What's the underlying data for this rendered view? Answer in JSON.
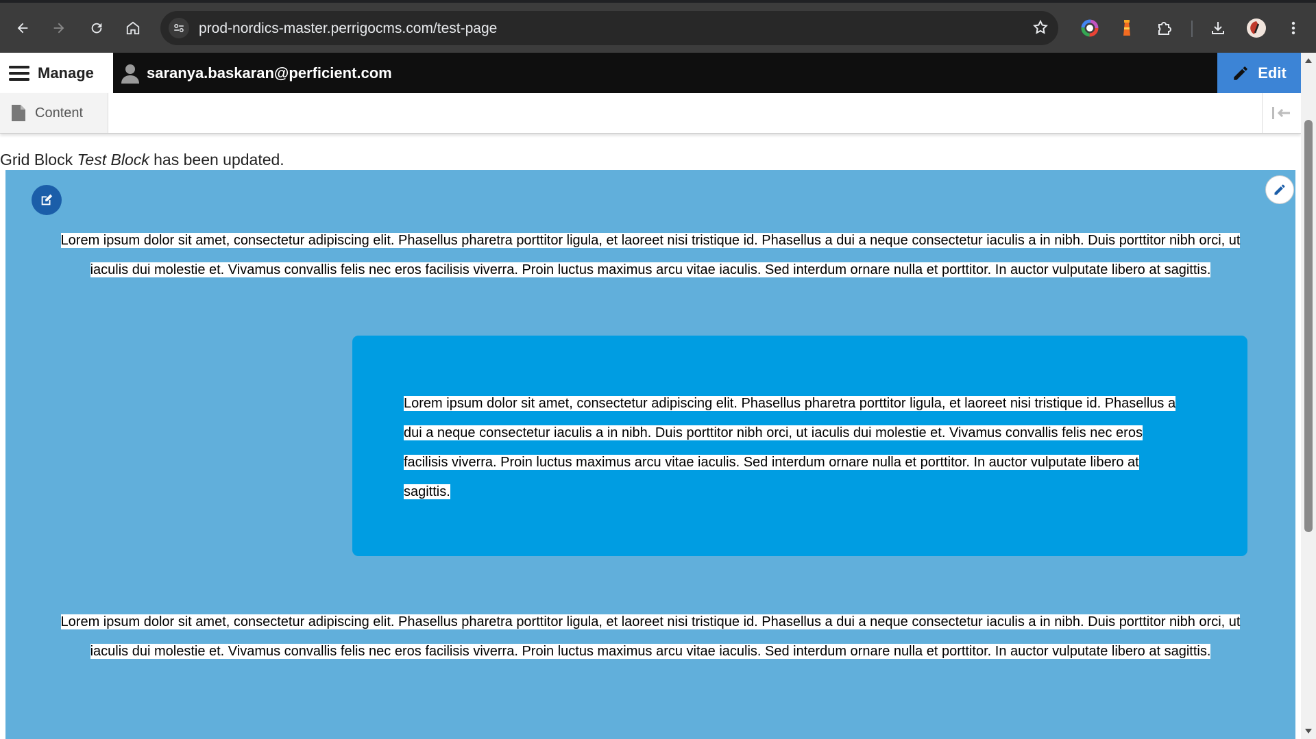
{
  "browser": {
    "url": "prod-nordics-master.perrigocms.com/test-page"
  },
  "toolbar": {
    "manage_label": "Manage",
    "user_label": "saranya.baskaran@perficient.com",
    "edit_label": "Edit",
    "tray_content_label": "Content"
  },
  "status": {
    "prefix": "Grid Block ",
    "block_name": "Test Block",
    "suffix": " has been updated."
  },
  "grid_block": {
    "background_color": "#61afdb",
    "top_text": "Lorem ipsum dolor sit amet, consectetur adipiscing elit. Phasellus pharetra porttitor ligula, et laoreet nisi tristique id. Phasellus a dui a neque consectetur iaculis a in nibh. Duis porttitor nibh orci, ut iaculis dui molestie et. Vivamus convallis felis nec eros facilisis viverra. Proin luctus maximus arcu vitae iaculis. Sed interdum ornare nulla et porttitor. In auctor vulputate libero at sagittis.",
    "inner_card": {
      "background_color": "#009de2",
      "text": "Lorem ipsum dolor sit amet, consectetur adipiscing elit. Phasellus pharetra porttitor ligula, et laoreet nisi tristique id. Phasellus a dui a neque consectetur iaculis a in nibh. Duis porttitor nibh orci, ut iaculis dui molestie et. Vivamus convallis felis nec eros facilisis viverra. Proin luctus maximus arcu vitae iaculis. Sed interdum ornare nulla et porttitor. In auctor vulputate libero at sagittis."
    },
    "bottom_text": "Lorem ipsum dolor sit amet, consectetur adipiscing elit. Phasellus pharetra porttitor ligula, et laoreet nisi tristique id. Phasellus a dui a neque consectetur iaculis a in nibh. Duis porttitor nibh orci, ut iaculis dui molestie et. Vivamus convallis felis nec eros facilisis viverra. Proin luctus maximus arcu vitae iaculis. Sed interdum ornare nulla et porttitor. In auctor vulputate libero at sagittis."
  },
  "icons": {
    "back": "arrow-left-icon",
    "forward": "arrow-right-icon",
    "reload": "reload-icon",
    "home": "home-icon",
    "site_info": "tune-icon",
    "bookmark": "star-icon",
    "extensions": "puzzle-icon",
    "download": "download-icon",
    "menu": "kebab-menu-icon",
    "manage": "hamburger-icon",
    "user": "person-icon",
    "edit": "pencil-icon",
    "content": "document-icon",
    "collapse_tray": "collapse-icon",
    "block_edit": "edit-square-icon",
    "contextual": "pencil-icon"
  }
}
